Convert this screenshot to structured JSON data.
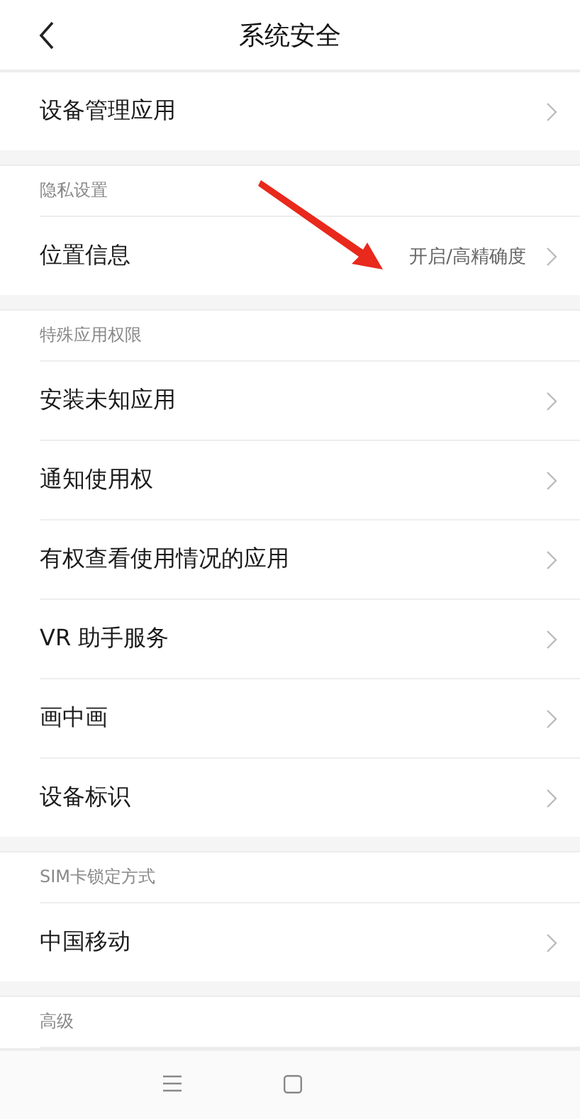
{
  "header": {
    "title": "系统安全"
  },
  "groups": [
    {
      "rows": [
        {
          "label": "设备管理应用"
        }
      ]
    },
    {
      "heading": "隐私设置",
      "rows": [
        {
          "label": "位置信息",
          "value": "开启/高精确度"
        }
      ]
    },
    {
      "heading": "特殊应用权限",
      "rows": [
        {
          "label": "安装未知应用"
        },
        {
          "label": "通知使用权"
        },
        {
          "label": "有权查看使用情况的应用"
        },
        {
          "label": "VR 助手服务"
        },
        {
          "label": "画中画"
        },
        {
          "label": "设备标识"
        }
      ]
    },
    {
      "heading": "SIM卡锁定方式",
      "rows": [
        {
          "label": "中国移动"
        }
      ]
    },
    {
      "heading": "高级"
    }
  ]
}
